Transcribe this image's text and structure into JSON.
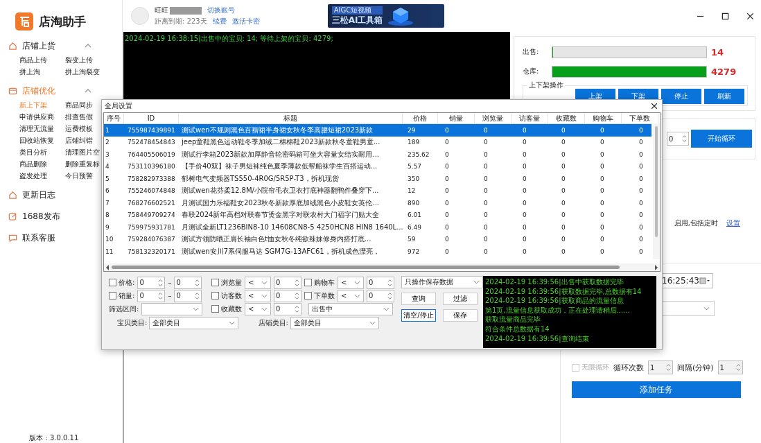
{
  "app": {
    "name": "店淘助手"
  },
  "sidebar": {
    "sections": [
      {
        "label": "店铺上货",
        "expanded": true,
        "selected": false,
        "items": [
          {
            "label": "商品上传",
            "selected": false
          },
          {
            "label": "裂变上传",
            "selected": false
          },
          {
            "label": "拼上淘",
            "selected": false
          },
          {
            "label": "拼上淘裂变",
            "selected": false
          }
        ]
      },
      {
        "label": "店铺优化",
        "expanded": true,
        "selected": true,
        "items": [
          {
            "label": "新上下架",
            "selected": true
          },
          {
            "label": "商品同步",
            "selected": false
          },
          {
            "label": "申请供应商",
            "selected": false
          },
          {
            "label": "排查售假",
            "selected": false
          },
          {
            "label": "清理无流量",
            "selected": false
          },
          {
            "label": "运费模板",
            "selected": false
          },
          {
            "label": "回收站恢复",
            "selected": false
          },
          {
            "label": "店铺纠错",
            "selected": false
          },
          {
            "label": "类目分析",
            "selected": false
          },
          {
            "label": "清理图片空",
            "selected": false
          },
          {
            "label": "商品删除",
            "selected": false
          },
          {
            "label": "删除重复标",
            "selected": false
          },
          {
            "label": "盗发处理",
            "selected": false
          },
          {
            "label": "今日预警",
            "selected": false
          }
        ]
      }
    ],
    "links": [
      "更新日志",
      "1688发布",
      "联系客服"
    ],
    "version": "版本：3.0.0.11"
  },
  "header": {
    "account_label": "旺旺",
    "switch_link": "切换账号",
    "expiry": "距离到期: 223天",
    "renew_link": "续费",
    "activate_link": "激活卡密",
    "banner": {
      "line1": "AIGC短视频",
      "line2": "三松AI工具箱"
    }
  },
  "main_log": [
    "2024-02-19 16:38:15|出售中的宝贝: 14; 等待上架的宝贝: 4279;"
  ],
  "stock": [
    {
      "label": "出售:",
      "level": 0.004,
      "count": "14"
    },
    {
      "label": "仓库:",
      "level": 1,
      "count": "4279"
    }
  ],
  "shelf_group": {
    "title": "上下架操作",
    "buttons": [
      "上架",
      "下架",
      "停止",
      "刷新"
    ]
  },
  "loop": {
    "spinner": "0",
    "button": "开始循环"
  },
  "schedule_note": {
    "text": "启用,包括定时",
    "link": "设置"
  },
  "task": {
    "time": "16:25:43",
    "infinite_loop": {
      "label": "无限循环",
      "checked": false,
      "disabled": true
    },
    "count_label": "循环次数",
    "count": "1",
    "interval_label": "间隔(分钟)",
    "interval": "1",
    "button": "添加任务"
  },
  "dialog": {
    "title": "全局设置",
    "columns": [
      "序号",
      "ID",
      "标题",
      "价格",
      "销量",
      "浏览量",
      "访客量",
      "收藏数",
      "购物车",
      "下单数"
    ],
    "rows": [
      {
        "selected": true,
        "cells": [
          "1",
          "755987439891",
          "测试wen不规则黑色百褶裙半身裙女秋冬季高腰短裙2023新款",
          "29",
          "0",
          "0",
          "0",
          "0",
          "0",
          "0"
        ]
      },
      {
        "selected": false,
        "cells": [
          "2",
          "752478454843",
          "jeep童鞋黑色运动鞋冬季加绒二棉棉鞋2023新款秋冬童鞋男童...",
          "189",
          "0",
          "0",
          "0",
          "0",
          "0",
          "0"
        ]
      },
      {
        "selected": false,
        "cells": [
          "3",
          "764405506019",
          "测试行李箱2023新款加厚静音轮密码箱可坐大容量女结实耐用...",
          "235.62",
          "0",
          "0",
          "0",
          "0",
          "0",
          "0"
        ]
      },
      {
        "selected": false,
        "cells": [
          "4",
          "753110396180",
          "【手价40双】袜子男短袜纯色夏季薄款低帮船袜学生百搭运动...",
          "5.57",
          "0",
          "0",
          "0",
          "0",
          "0",
          "0"
        ]
      },
      {
        "selected": false,
        "cells": [
          "5",
          "758282973388",
          "郁树电气变频器TS550-4R0G/5R5P-T3，拆机现货",
          "350",
          "0",
          "0",
          "0",
          "0",
          "0",
          "0"
        ]
      },
      {
        "selected": false,
        "cells": [
          "6",
          "755246074848",
          "测试wen花芬柔12.8M/小院帘毛衣卫衣打底神器翻鸭件叠穿下...",
          "12",
          "0",
          "0",
          "0",
          "0",
          "0",
          "0"
        ]
      },
      {
        "selected": false,
        "cells": [
          "7",
          "768276602521",
          "月测试国力乐福鞋女2023秋冬新款厚底加绒黑色小皮鞋女英伦...",
          "890",
          "0",
          "0",
          "0",
          "0",
          "0",
          "0"
        ]
      },
      {
        "selected": false,
        "cells": [
          "8",
          "758449709274",
          "春联2024新年高档对联春节烫金黑字对联农村大门福字门贴大全",
          "6.01",
          "0",
          "0",
          "0",
          "0",
          "0",
          "0"
        ]
      },
      {
        "selected": false,
        "cells": [
          "9",
          "759975931781",
          "月测试全新LT1236BIN8-10 14608CN8-5 4250HCN8 HIN8 1640L...",
          "6.49",
          "0",
          "0",
          "0",
          "0",
          "0",
          "0"
        ]
      },
      {
        "selected": false,
        "cells": [
          "10",
          "759284076387",
          "测试方领防晒正肩长袖白色t恤女秋冬纯欲辣妹修身内搭打底...",
          "59",
          "0",
          "0",
          "0",
          "0",
          "0",
          "0"
        ]
      },
      {
        "selected": false,
        "cells": [
          "11",
          "758132320171",
          "测试wen安川7系伺服马达 SGM7G-13AFC61，拆机成色漂亮，",
          "972",
          "0",
          "0",
          "0",
          "0",
          "0",
          "0"
        ]
      }
    ],
    "filters": {
      "ranges": [
        {
          "label": "价格:",
          "checked": false,
          "min": "0",
          "max": "0",
          "dash": "–"
        },
        {
          "label": "销量:",
          "checked": false,
          "min": "0",
          "max": "0",
          "dash": "–"
        }
      ],
      "interval_label": "筛选区间:",
      "compares": [
        {
          "label": "浏览量",
          "checked": false,
          "op": "<",
          "value": "0"
        },
        {
          "label": "访客数",
          "checked": false,
          "op": "<",
          "value": "0"
        },
        {
          "label": "收藏数",
          "checked": false,
          "op": "<",
          "value": "0"
        },
        {
          "label": "购物车",
          "checked": false,
          "op": "<",
          "value": "0"
        },
        {
          "label": "下单数",
          "checked": false,
          "op": "<",
          "value": "0"
        }
      ],
      "status": "出售中",
      "categories": [
        {
          "label": "宝贝类目:",
          "value": "全部类目"
        },
        {
          "label": "店铺类目:",
          "value": "全部类目"
        }
      ]
    },
    "mode": "只操作保存数据",
    "buttons": [
      {
        "label": "查询",
        "focused": false
      },
      {
        "label": "过滤",
        "focused": false
      },
      {
        "label": "清空/停止",
        "focused": true
      },
      {
        "label": "保存",
        "focused": false
      }
    ],
    "log": [
      "2024-02-19 16:39:56|出售中获取数据完毕",
      "2024-02-19 16:39:56|获取数据完毕,总数据有14",
      "2024-02-19 16:39:56|获取商品的流量信息",
      "第1页,流量信息获取成功，正在处理请稍后......",
      "获取流量商品完毕",
      "符合条件总数据有14",
      "2024-02-19 16:39:56|查询结束"
    ]
  }
}
